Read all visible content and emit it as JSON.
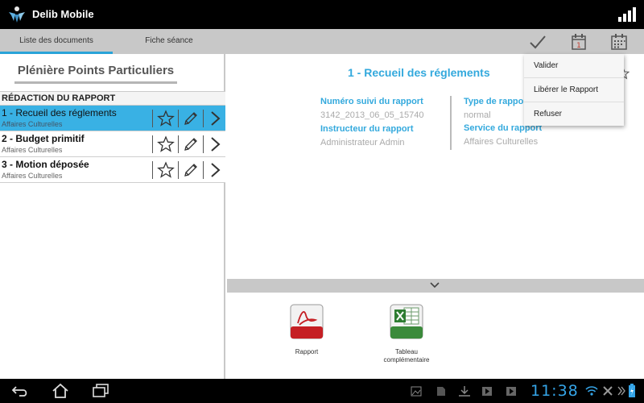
{
  "app": {
    "title": "Delib Mobile"
  },
  "tabs": [
    {
      "label": "Liste des documents",
      "active": true
    },
    {
      "label": "Fiche séance",
      "active": false
    }
  ],
  "toolbar": {
    "icons": [
      "check-icon",
      "calendar-day-icon",
      "calendar-grid-icon"
    ],
    "calendar_day_number": "1"
  },
  "menu": {
    "items": [
      "Valider",
      "Libérer le Rapport",
      "Refuser"
    ]
  },
  "left_panel": {
    "title": "Plénière Points Particuliers",
    "section": "RÉDACTION DU RAPPORT",
    "items": [
      {
        "title": "1 - Recueil des réglements",
        "subtitle": "Affaires Culturelles",
        "selected": true
      },
      {
        "title": "2 - Budget primitif",
        "subtitle": "Affaires Culturelles",
        "selected": false
      },
      {
        "title": "3 - Motion déposée",
        "subtitle": "Affaires Culturelles",
        "selected": false
      }
    ]
  },
  "detail": {
    "title": "1 - Recueil des réglements",
    "fields": {
      "numero_label": "Numéro suivi du rapport",
      "numero_value": "3142_2013_06_05_15740",
      "instructeur_label": "Instructeur du rapport",
      "instructeur_value": "Administrateur Admin",
      "type_label": "Type de rapport",
      "type_value": "normal",
      "service_label": "Service du rapport",
      "service_value": "Affaires Culturelles"
    }
  },
  "documents": [
    {
      "label": "Rapport",
      "icon": "pdf-icon"
    },
    {
      "label": "Tableau complémentaire",
      "icon": "excel-icon"
    }
  ],
  "system_bar": {
    "clock": "11:38"
  },
  "colors": {
    "accent": "#33a9dd",
    "selected_row": "#39b1e4",
    "tab_bar": "#c8c8c8"
  }
}
